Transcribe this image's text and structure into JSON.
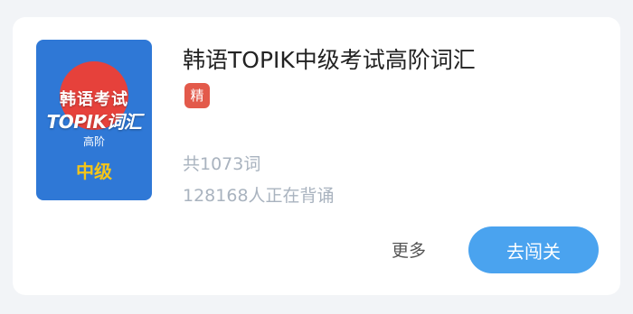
{
  "book": {
    "cover": {
      "line1": "韩语考试",
      "line2": "TOPIK词汇",
      "line3": "高阶",
      "level": "中级"
    },
    "title": "韩语TOPIK中级考试高阶词汇",
    "badge": "精",
    "word_count": "共1073词",
    "learners": "128168人正在背诵"
  },
  "actions": {
    "more_label": "更多",
    "go_label": "去闯关"
  },
  "colors": {
    "accent": "#4aa3ef",
    "badge": "#e35a4b",
    "cover": "#2f78d6",
    "cover_circle": "#e6413b",
    "level_text": "#f5c518",
    "muted_text": "#a9b3bf"
  }
}
